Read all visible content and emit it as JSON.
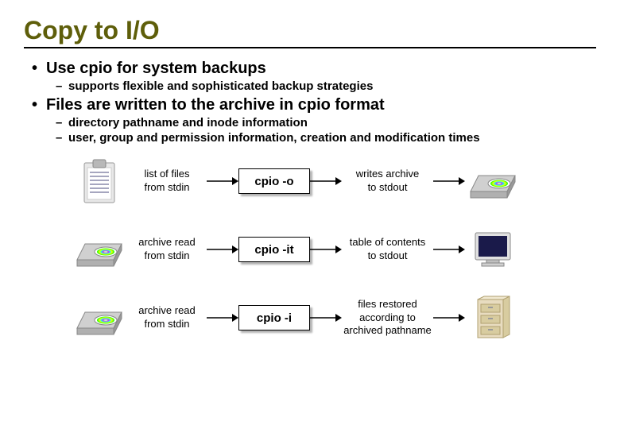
{
  "title": "Copy to I/O",
  "bullets": [
    {
      "text": "Use cpio for system backups",
      "sub": [
        "supports flexible and sophisticated backup strategies"
      ]
    },
    {
      "text": "Files are written to the archive in cpio format",
      "sub": [
        "directory pathname and inode information",
        "user, group and permission information, creation and modification times"
      ]
    }
  ],
  "rows": [
    {
      "input_icon": "clipboard",
      "input_label_1": "list of files",
      "input_label_2": "from stdin",
      "command": "cpio -o",
      "output_label_1": "writes archive",
      "output_label_2": "to stdout",
      "output_label_3": "",
      "output_icon": "cdwriter"
    },
    {
      "input_icon": "cdwriter",
      "input_label_1": "archive read",
      "input_label_2": "from stdin",
      "command": "cpio -it",
      "output_label_1": "table of contents",
      "output_label_2": "to stdout",
      "output_label_3": "",
      "output_icon": "monitor"
    },
    {
      "input_icon": "cdwriter",
      "input_label_1": "archive read",
      "input_label_2": "from stdin",
      "command": "cpio -i",
      "output_label_1": "files restored",
      "output_label_2": "according to",
      "output_label_3": "archived pathname",
      "output_icon": "cabinet"
    }
  ]
}
